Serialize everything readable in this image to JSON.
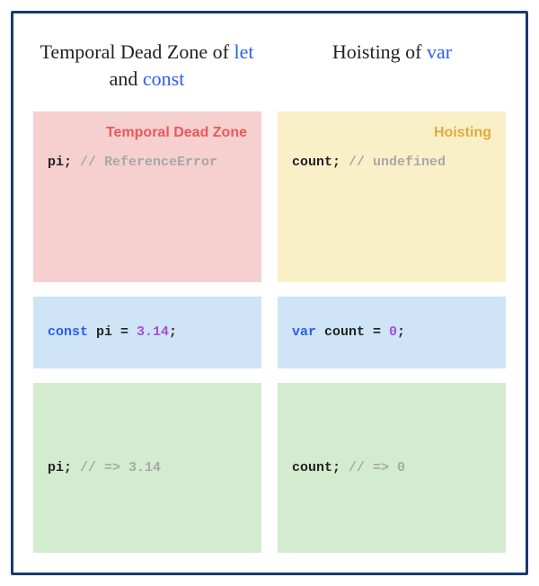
{
  "headings": {
    "left_pre": "Temporal Dead Zone of ",
    "left_kw1": "let",
    "left_mid": " and ",
    "left_kw2": "const",
    "right_pre": "Hoisting of ",
    "right_kw": "var"
  },
  "labels": {
    "tdz": "Temporal Dead Zone",
    "hoisting": "Hoisting"
  },
  "code": {
    "tdz_var": "pi;",
    "tdz_comment": " // ReferenceError",
    "hoist_var": "count;",
    "hoist_comment": " // undefined",
    "decl_const_kw": "const",
    "decl_const_rest": " pi = ",
    "decl_const_num": "3.14",
    "decl_const_end": ";",
    "decl_var_kw": "var",
    "decl_var_rest": " count = ",
    "decl_var_num": "0",
    "decl_var_end": ";",
    "after_pi": "pi;",
    "after_pi_comment": " // => 3.14",
    "after_count": "count;",
    "after_count_comment": " // => 0"
  }
}
